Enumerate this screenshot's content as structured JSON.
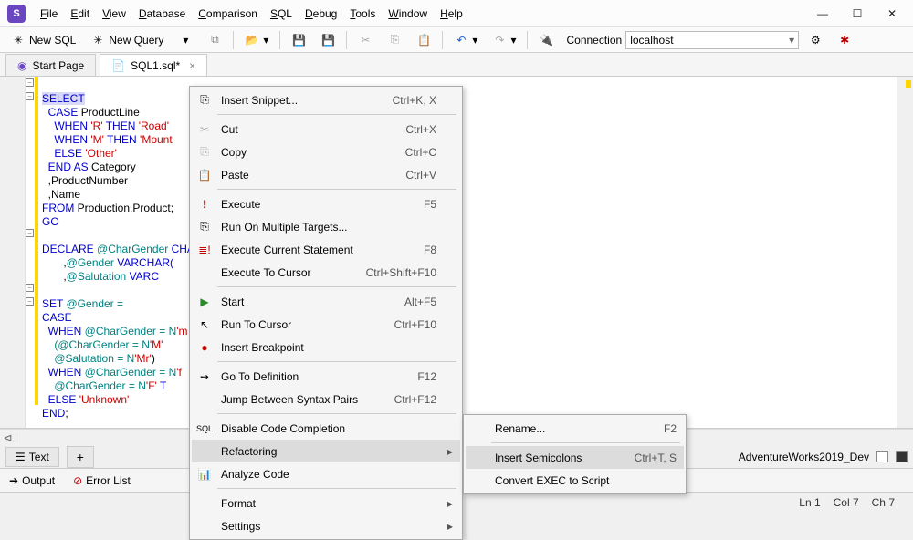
{
  "menu": {
    "file": "File",
    "edit": "Edit",
    "view": "View",
    "database": "Database",
    "comparison": "Comparison",
    "sql": "SQL",
    "debug": "Debug",
    "tools": "Tools",
    "window": "Window",
    "help": "Help"
  },
  "toolbar": {
    "newsql": "New SQL",
    "newquery": "New Query",
    "connection_label": "Connection",
    "connection_value": "localhost"
  },
  "tabs": {
    "start": "Start Page",
    "sql1": "SQL1.sql*"
  },
  "code": {
    "l1a": "SELECT",
    "l1sel": "",
    "l2a": "  CASE",
    "l2b": " ProductLine",
    "l3a": "    WHEN ",
    "l3b": "'R'",
    "l3c": " THEN ",
    "l3d": "'Road'",
    "l4a": "    WHEN ",
    "l4b": "'M'",
    "l4c": " THEN ",
    "l4d": "'Mount",
    "l5a": "    ELSE ",
    "l5b": "'Other'",
    "l6a": "  END AS",
    "l6b": " Category",
    "l7": "  ,ProductNumber",
    "l8": "  ,Name",
    "l9a": "FROM",
    "l9b": " Production.Product;",
    "l10": "GO",
    "l12a": "DECLARE",
    "l12b": " @CharGender ",
    "l12c": "CHAR(",
    "l13a": "       ,",
    "l13b": "@Gender ",
    "l13c": "VARCHAR(",
    "l14a": "       ,",
    "l14b": "@Salutation ",
    "l14c": "VARC",
    "l16a": "SET",
    "l16b": " @Gender =",
    "l17": "CASE",
    "l18a": "  WHEN",
    "l18b": " @CharGender = N",
    "l18c": "'m",
    "l19a": "    (@CharGender = N",
    "l19b": "'M'",
    "l20a": "    @Salutation = N",
    "l20b": "'Mr'",
    ")": ")",
    "l21a": "  WHEN",
    "l21b": " @CharGender = N",
    "l21c": "'f",
    "l22a": "    @CharGender = N",
    "l22b": "'F'",
    "l22c": " T",
    "l23a": "  ELSE ",
    "l23b": "'Unknown'",
    "l24a": "END",
    ";": ";"
  },
  "ctx": {
    "insert_snippet": "Insert Snippet...",
    "k_snippet": "Ctrl+K, X",
    "cut": "Cut",
    "k_cut": "Ctrl+X",
    "copy": "Copy",
    "k_copy": "Ctrl+C",
    "paste": "Paste",
    "k_paste": "Ctrl+V",
    "execute": "Execute",
    "k_execute": "F5",
    "run_multi": "Run On Multiple Targets...",
    "exec_cur": "Execute Current Statement",
    "k_exec_cur": "F8",
    "exec_cursor": "Execute To Cursor",
    "k_exec_cursor": "Ctrl+Shift+F10",
    "start": "Start",
    "k_start": "Alt+F5",
    "run_cursor": "Run To Cursor",
    "k_run_cursor": "Ctrl+F10",
    "insert_bp": "Insert Breakpoint",
    "goto_def": "Go To Definition",
    "k_goto_def": "F12",
    "jump_syntax": "Jump Between Syntax Pairs",
    "k_jump": "Ctrl+F12",
    "disable_cc": "Disable Code Completion",
    "refactoring": "Refactoring",
    "analyze": "Analyze Code",
    "format": "Format",
    "settings": "Settings"
  },
  "sub": {
    "rename": "Rename...",
    "k_rename": "F2",
    "insert_semi": "Insert Semicolons",
    "k_insert_semi": "Ctrl+T, S",
    "convert_exec": "Convert EXEC to Script"
  },
  "bottom": {
    "text": "Text",
    "db": "AdventureWorks2019_Dev",
    "output": "Output",
    "errorlist": "Error List"
  },
  "status": {
    "ln": "Ln 1",
    "col": "Col 7",
    "ch": "Ch 7"
  }
}
